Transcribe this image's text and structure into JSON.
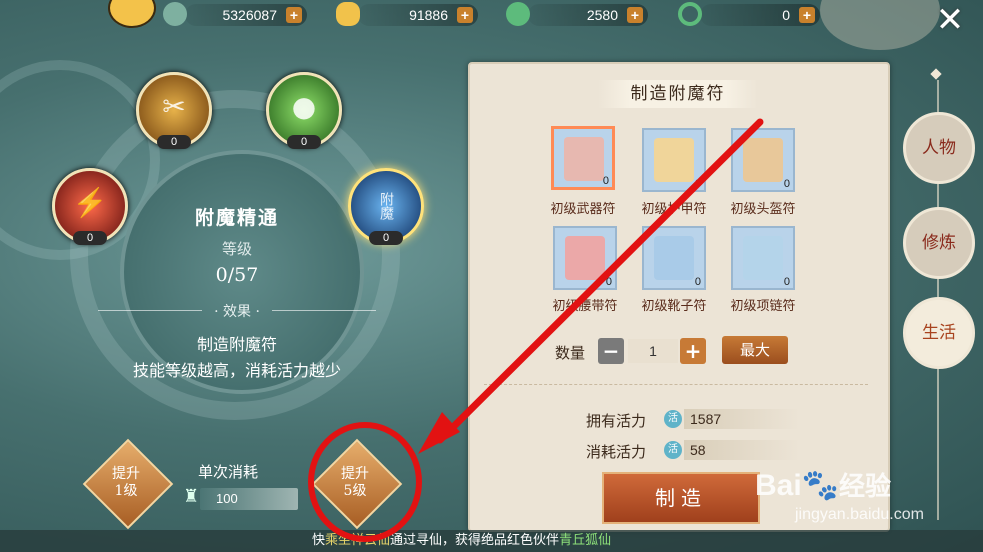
{
  "resources": [
    {
      "icon": "gold-coin-icon",
      "value": "5326087"
    },
    {
      "icon": "silver-ingot-icon",
      "value": "91886"
    },
    {
      "icon": "jade-token-icon",
      "value": "2580"
    },
    {
      "icon": "jade-ring-icon",
      "value": "0"
    }
  ],
  "skills": [
    {
      "icon": "scroll-gold-icon",
      "count": "0"
    },
    {
      "icon": "green-jade-icon",
      "count": "0"
    },
    {
      "icon": "red-slash-icon",
      "count": "0"
    },
    {
      "icon": "blue-talisman-icon",
      "count": "0",
      "glyph": "附魔"
    }
  ],
  "skill_detail": {
    "name": "附魔精通",
    "level_label": "等级",
    "level_value": "0/57",
    "effect_header": "效果",
    "effect_title": "制造附魔符",
    "effect_desc": "技能等级越高，消耗活力越少"
  },
  "upgrade": {
    "one_label_a": "提升",
    "one_label_b": "1级",
    "cost_label": "单次消耗",
    "cost_value": "100",
    "five_label_a": "提升",
    "five_label_b": "5级"
  },
  "craft": {
    "title": "制造附魔符",
    "items": [
      {
        "label": "初级武器符",
        "count": "0",
        "color": "#e7b8b0"
      },
      {
        "label": "初级护甲符",
        "count": "0",
        "color": "#f0d59a"
      },
      {
        "label": "初级头盔符",
        "count": "0",
        "color": "#e8c89a"
      },
      {
        "label": "初级腰带符",
        "count": "0",
        "color": "#eba8a8"
      },
      {
        "label": "初级靴子符",
        "count": "0",
        "color": "#a9cbe8"
      },
      {
        "label": "初级项链符",
        "count": "0",
        "color": "#b4d4ea"
      }
    ],
    "qty_label": "数量",
    "qty_value": "1",
    "minus": "−",
    "plus": "+",
    "max_label": "最大",
    "own_label": "拥有活力",
    "own_value": "1587",
    "cost_label": "消耗活力",
    "cost_value": "58",
    "energy_icon_text": "活",
    "make_label": "制造"
  },
  "tabs": [
    {
      "label": "人物",
      "active": false
    },
    {
      "label": "修炼",
      "active": false
    },
    {
      "label": "生活",
      "active": true
    }
  ],
  "footer": {
    "pre": "快",
    "hl1": "乘坐",
    "hl2": "祥云仙",
    "mid": "通过寻仙，获得绝品红色伙伴",
    "hl3": "青丘狐仙"
  },
  "watermark": {
    "brand": "Bai",
    "brand2": "经验",
    "url": "jingyan.baidu.com"
  },
  "colors": {
    "accent": "#a0401c",
    "annotation": "#e21212",
    "background": "#47706f"
  }
}
